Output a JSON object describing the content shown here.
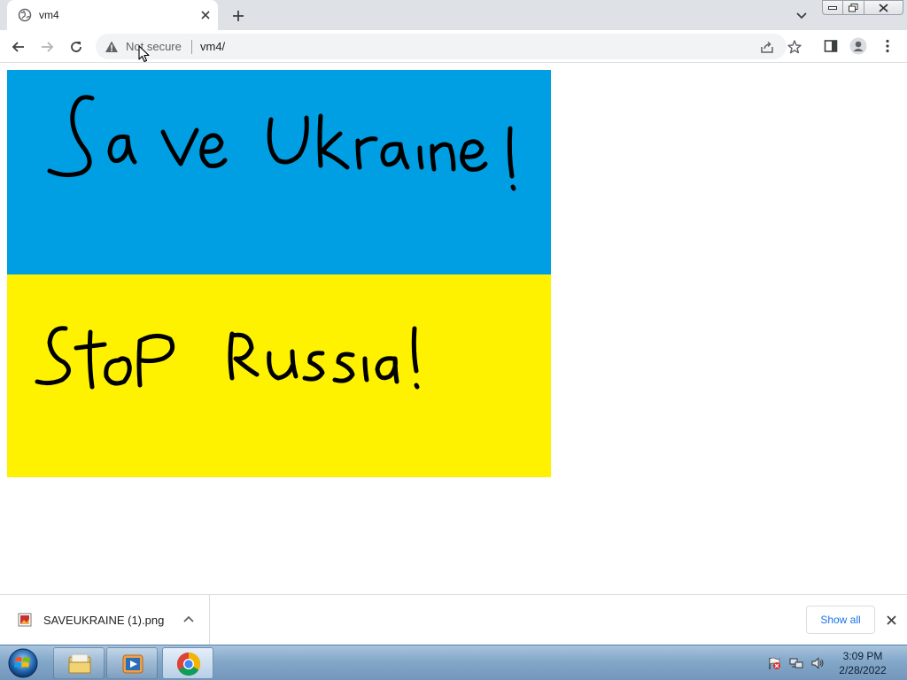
{
  "browser": {
    "tab": {
      "title": "vm4"
    },
    "omnibox": {
      "security_label": "Not secure",
      "url": "vm4/"
    }
  },
  "download_bar": {
    "items": [
      {
        "filename": "SAVEUKRAINE (1).png"
      }
    ],
    "show_all_label": "Show all"
  },
  "taskbar": {
    "clock": {
      "time": "3:09 PM",
      "date": "2/28/2022"
    },
    "pinned": [
      "windows-explorer",
      "media-player",
      "chrome"
    ]
  },
  "content": {
    "image": {
      "top_text": "Save Ukraine!",
      "bottom_text": "Stop Russia!",
      "top_color": "#009fe3",
      "bottom_color": "#fff200"
    }
  }
}
